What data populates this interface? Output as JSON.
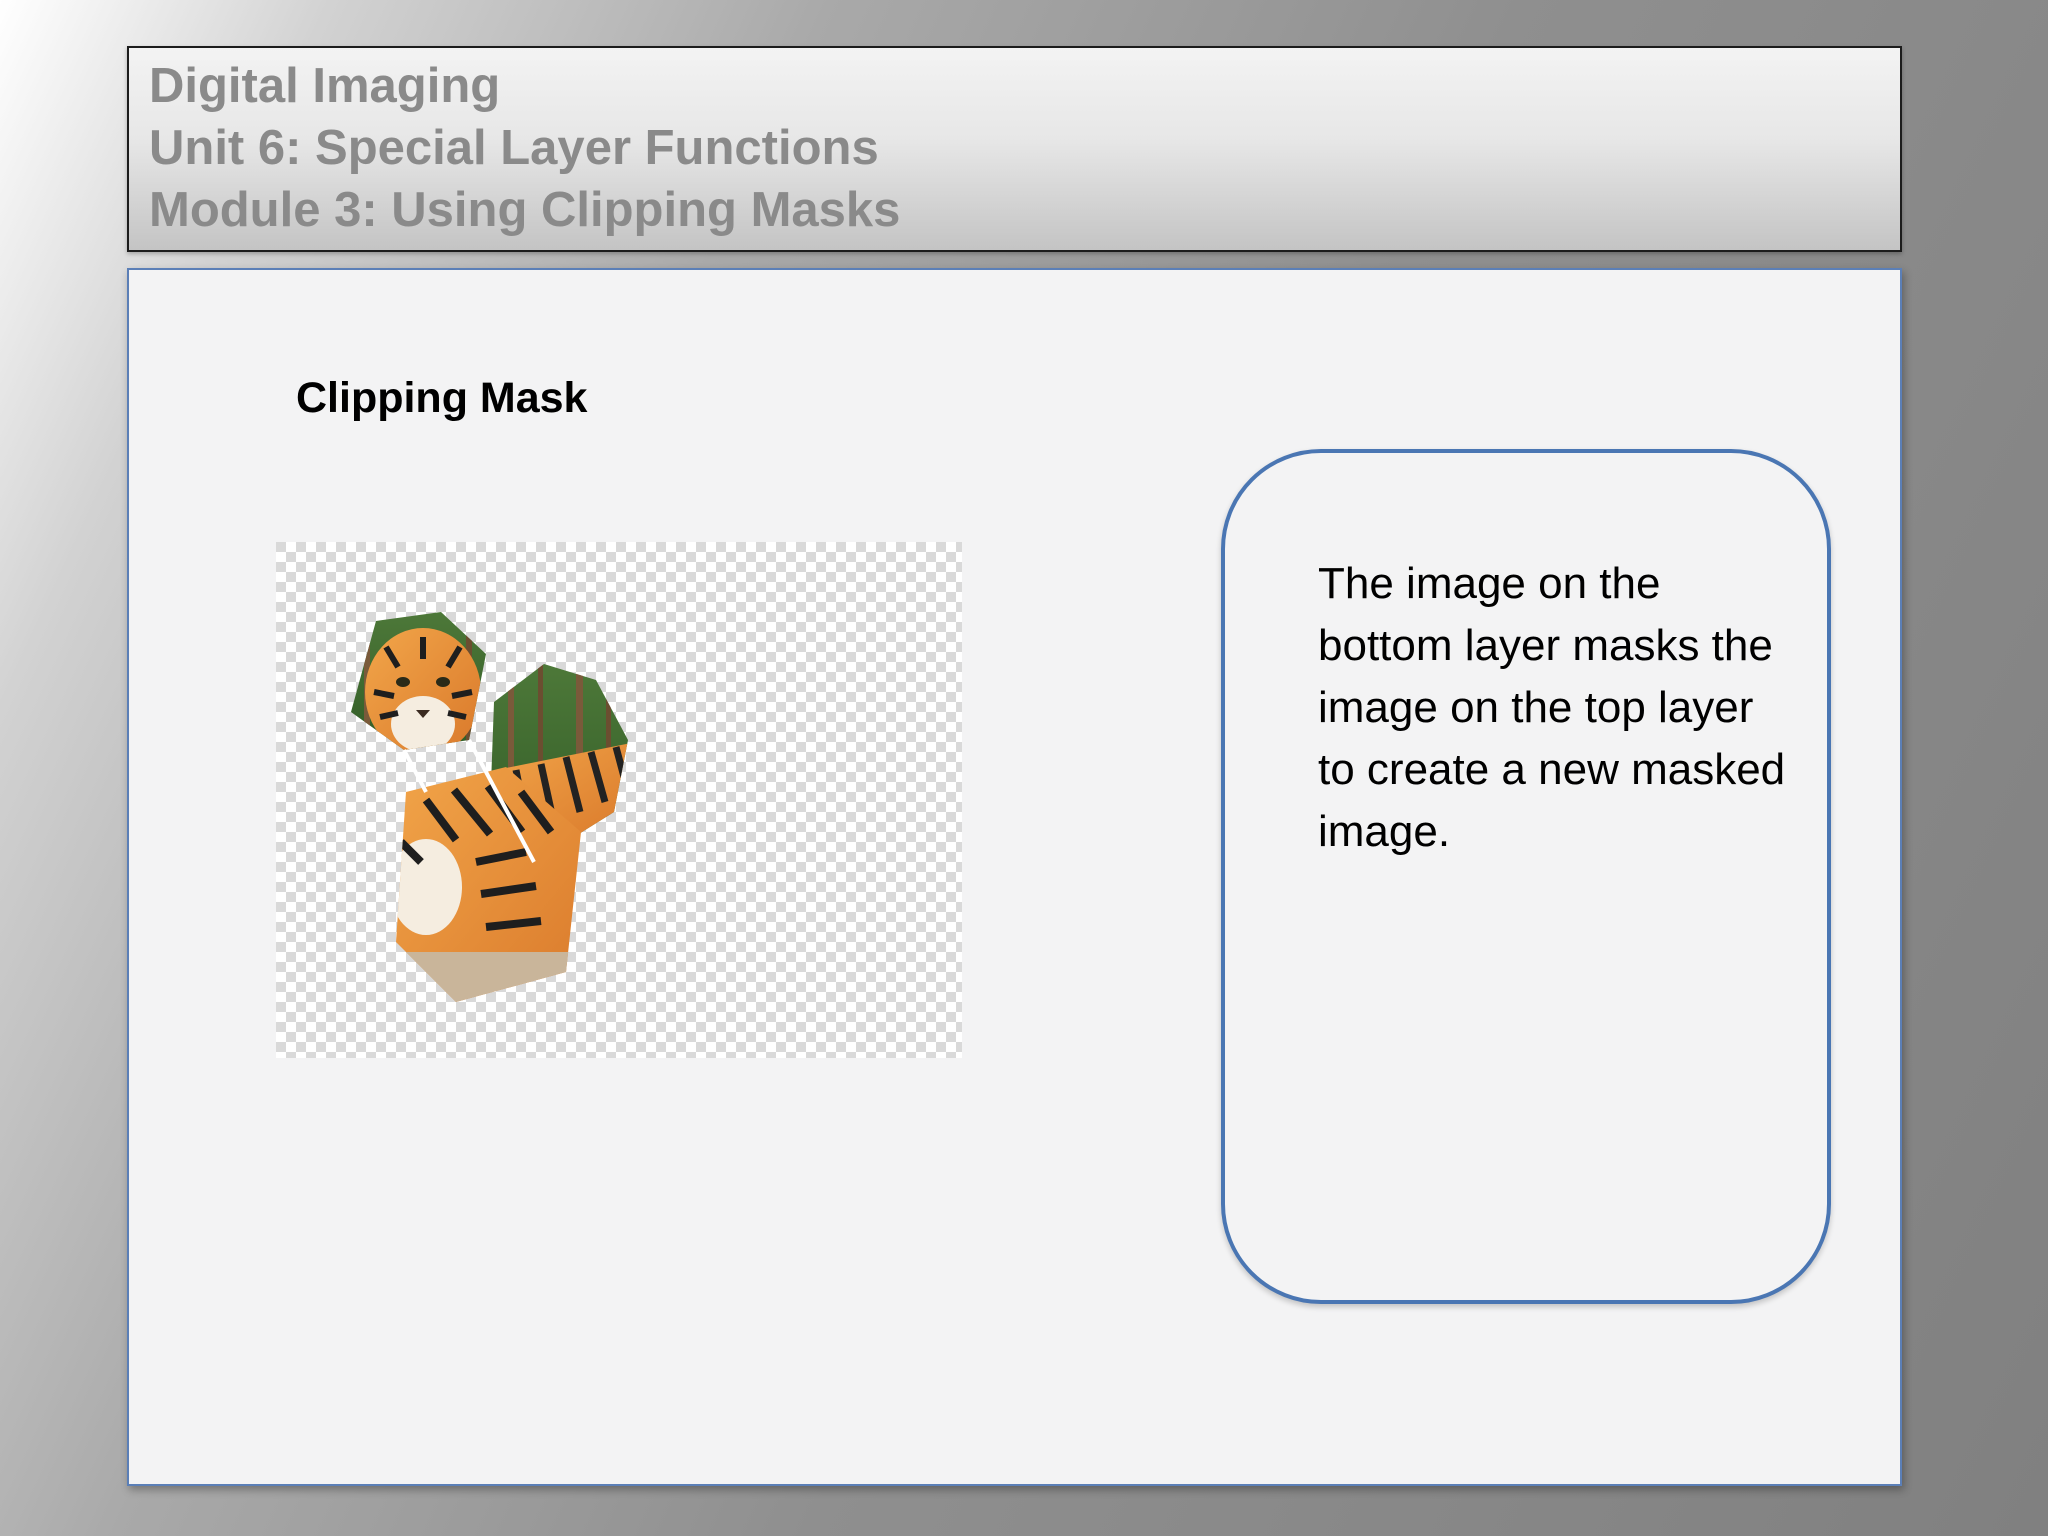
{
  "header": {
    "line1": "Digital Imaging",
    "line2": "Unit 6: Special Layer Functions",
    "line3": "Module 3: Using Clipping Masks"
  },
  "content": {
    "heading": "Clipping Mask",
    "callout": "The image on the bottom layer masks the image on the top layer to create a new masked image."
  },
  "colors": {
    "panel_border": "#5b7fb7",
    "callout_border": "#4a76b3",
    "header_text": "#8a8a8a"
  }
}
